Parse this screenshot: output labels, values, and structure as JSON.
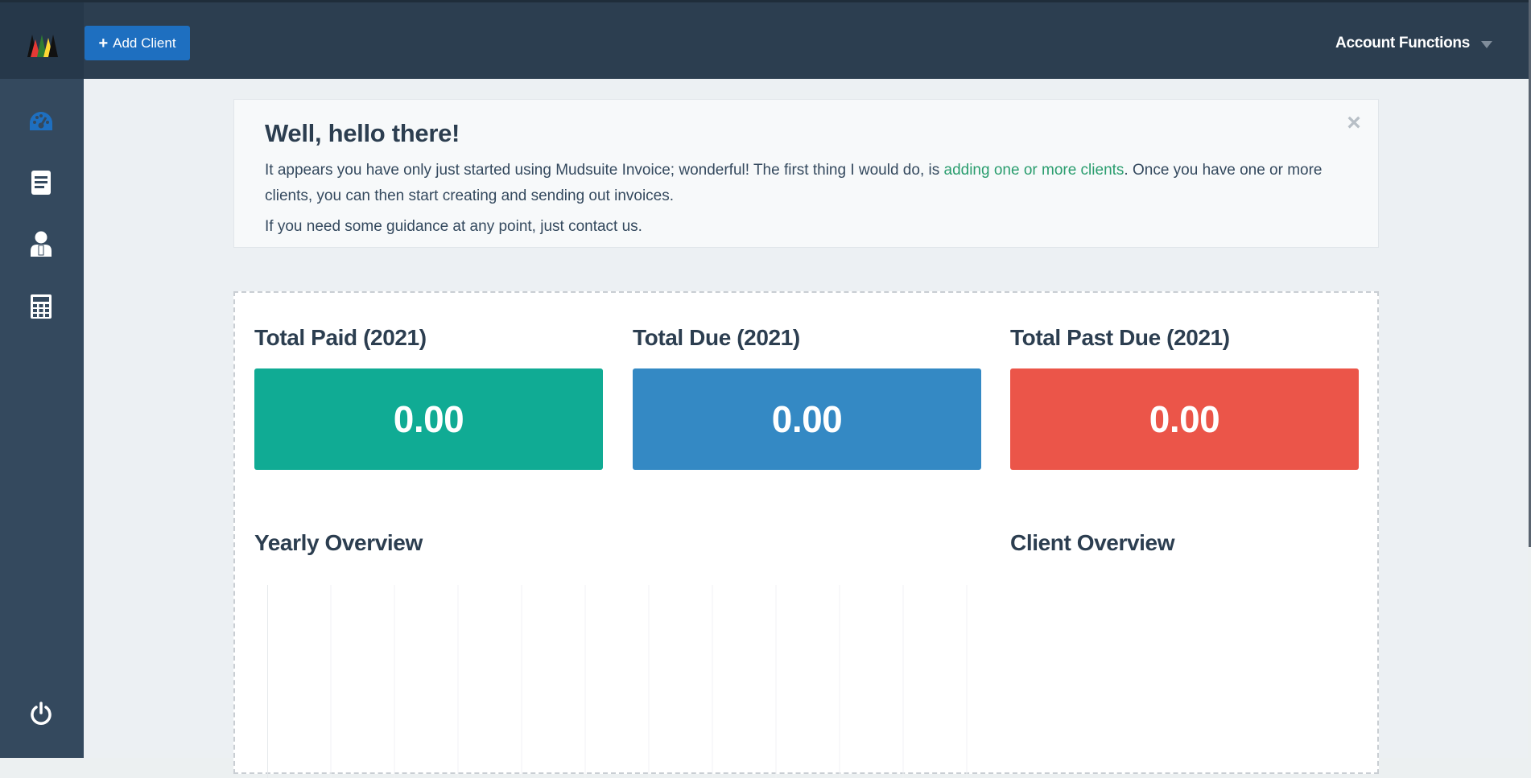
{
  "header": {
    "add_client_label": "Add Client",
    "account_functions_label": "Account Functions"
  },
  "sidebar": {
    "items": [
      {
        "icon": "dashboard-icon",
        "active": true
      },
      {
        "icon": "invoice-icon",
        "active": false
      },
      {
        "icon": "clients-icon",
        "active": false
      },
      {
        "icon": "calculator-icon",
        "active": false
      }
    ],
    "bottom_icon": "power-icon"
  },
  "welcome": {
    "title": "Well, hello there!",
    "text_before_link": "It appears you have only just started using Mudsuite Invoice; wonderful! The first thing I would do, is ",
    "link_text": "adding one or more clients",
    "text_after_link": ". Once you have one or more clients, you can then start creating and sending out invoices.",
    "guidance": "If you need some guidance at any point, just contact us.",
    "close_glyph": "×"
  },
  "stats": [
    {
      "title": "Total Paid (2021)",
      "value": "0.00",
      "color": "#10ab94"
    },
    {
      "title": "Total Due (2021)",
      "value": "0.00",
      "color": "#3489c4"
    },
    {
      "title": "Total Past Due (2021)",
      "value": "0.00",
      "color": "#eb5549"
    }
  ],
  "sections": {
    "yearly_overview": "Yearly Overview",
    "client_overview": "Client Overview"
  },
  "colors": {
    "topbar": "#2c3e50",
    "sidebar": "#34495e",
    "accent_blue": "#1e6fc0",
    "link_green": "#2a9d6e"
  }
}
